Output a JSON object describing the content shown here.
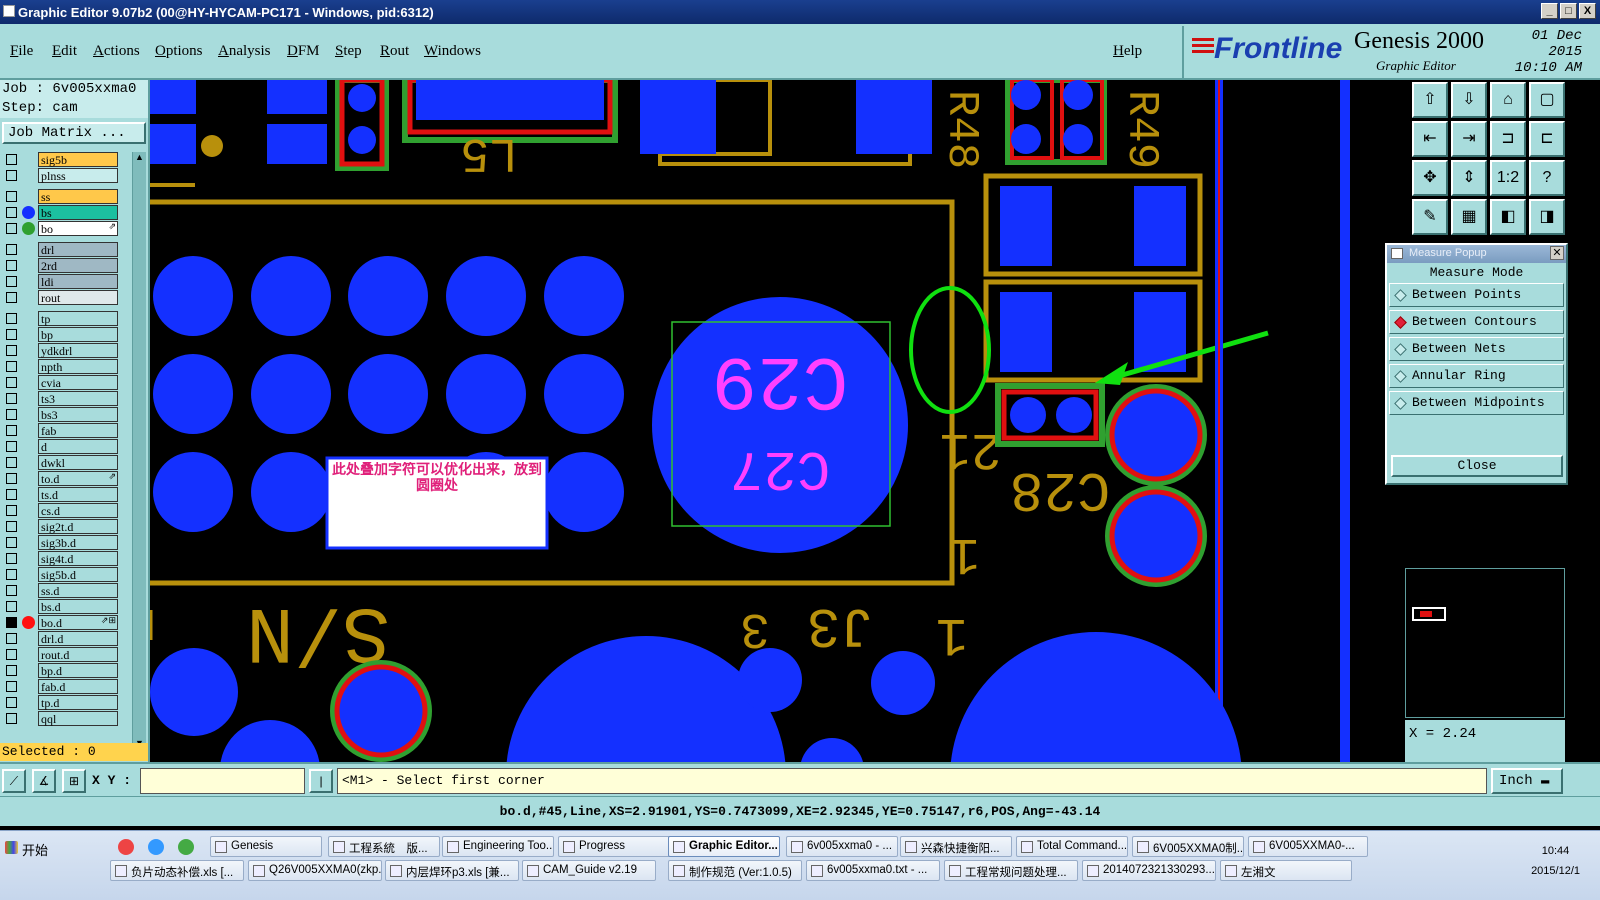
{
  "window": {
    "title": "Graphic Editor 9.07b2 (00@HY-HYCAM-PC171 - Windows, pid:6312)",
    "controls": [
      "_",
      "□",
      "X"
    ]
  },
  "menu": [
    "File",
    "Edit",
    "Actions",
    "Options",
    "Analysis",
    "DFM",
    "Step",
    "Rout",
    "Windows"
  ],
  "help": "Help",
  "brand": {
    "logo": "Frontline",
    "product": "Genesis 2000",
    "sub": "Graphic Editor",
    "date": "01 Dec 2015",
    "time": "10:10 AM",
    "logo_color": "#1a3fb0"
  },
  "job": {
    "job_label": "Job : 6v005xxma0",
    "step_label": "Step: cam",
    "matrix": "Job Matrix ..."
  },
  "layers": [
    {
      "name": "sig5b",
      "color": "#ffc84a",
      "dot": ""
    },
    {
      "name": "plnss",
      "color": "#c8ecec",
      "dot": "",
      "gap": true
    },
    {
      "name": "ss",
      "color": "#ffc84a",
      "dot": ""
    },
    {
      "name": "bs",
      "color": "#1cc0a0",
      "dot": "#1430ff"
    },
    {
      "name": "bo",
      "color": "#ffffff",
      "dot": "#30a030",
      "flag": "⇗",
      "gap": true
    },
    {
      "name": "drl",
      "color": "#9fb8c4",
      "dot": ""
    },
    {
      "name": "2rd",
      "color": "#9fb8c4",
      "dot": ""
    },
    {
      "name": "ldi",
      "color": "#9fb8c4",
      "dot": ""
    },
    {
      "name": "rout",
      "color": "#dfe8ea",
      "dot": "",
      "gap": true
    },
    {
      "name": "tp",
      "color": "#a8dcdc",
      "dot": ""
    },
    {
      "name": "bp",
      "color": "#a8dcdc",
      "dot": ""
    },
    {
      "name": "ydkdrl",
      "color": "#a8dcdc",
      "dot": ""
    },
    {
      "name": "npth",
      "color": "#a8dcdc",
      "dot": ""
    },
    {
      "name": "cvia",
      "color": "#a8dcdc",
      "dot": ""
    },
    {
      "name": "ts3",
      "color": "#a8dcdc",
      "dot": ""
    },
    {
      "name": "bs3",
      "color": "#a8dcdc",
      "dot": ""
    },
    {
      "name": "fab",
      "color": "#a8dcdc",
      "dot": ""
    },
    {
      "name": "d",
      "color": "#a8dcdc",
      "dot": ""
    },
    {
      "name": "dwkl",
      "color": "#a8dcdc",
      "dot": ""
    },
    {
      "name": "to.d",
      "color": "#a8dcdc",
      "dot": "",
      "flag": "⇗"
    },
    {
      "name": "ts.d",
      "color": "#a8dcdc",
      "dot": ""
    },
    {
      "name": "cs.d",
      "color": "#a8dcdc",
      "dot": ""
    },
    {
      "name": "sig2t.d",
      "color": "#a8dcdc",
      "dot": ""
    },
    {
      "name": "sig3b.d",
      "color": "#a8dcdc",
      "dot": ""
    },
    {
      "name": "sig4t.d",
      "color": "#a8dcdc",
      "dot": ""
    },
    {
      "name": "sig5b.d",
      "color": "#a8dcdc",
      "dot": ""
    },
    {
      "name": "ss.d",
      "color": "#a8dcdc",
      "dot": ""
    },
    {
      "name": "bs.d",
      "color": "#a8dcdc",
      "dot": ""
    },
    {
      "name": "bo.d",
      "color": "#a8dcdc",
      "dot": "#ff1010",
      "flag": "⇗⊞",
      "checked": true
    },
    {
      "name": "drl.d",
      "color": "#a8dcdc",
      "dot": ""
    },
    {
      "name": "rout.d",
      "color": "#a8dcdc",
      "dot": ""
    },
    {
      "name": "bp.d",
      "color": "#a8dcdc",
      "dot": ""
    },
    {
      "name": "fab.d",
      "color": "#a8dcdc",
      "dot": ""
    },
    {
      "name": "tp.d",
      "color": "#a8dcdc",
      "dot": ""
    },
    {
      "name": "qql",
      "color": "#a8dcdc",
      "dot": ""
    }
  ],
  "selected": "Selected : 0",
  "canvas": {
    "labels": {
      "c29": "C29",
      "c27": "C27",
      "c28": "C28",
      "l5": "L5",
      "r48": "R48",
      "r49": "R49",
      "sn": "S/N",
      "j3": "J3",
      "n1": "1",
      "n3": "3",
      "n1b": "1",
      "n21": "21"
    },
    "annotation": "此处叠加字符可以优化出来，放到圆圈处",
    "colors": {
      "pad": "#1430ff",
      "outline": "#b8900c",
      "silk": "#ff40ff",
      "mask": "#e01010",
      "green": "#30a030"
    }
  },
  "tools": [
    "⇧",
    "⇩",
    "⌂",
    "▢",
    "⇤",
    "⇥",
    "⊐",
    "⊏",
    "✥",
    "⇕",
    "1:2",
    "?",
    "✎",
    "▦",
    "◧",
    "◨"
  ],
  "measure": {
    "title": "Measure Popup",
    "heading": "Measure Mode",
    "options": [
      "Between Points",
      "Between Contours",
      "Between Nets",
      "Annular Ring",
      "Between Midpoints"
    ],
    "selected_index": 1,
    "close": "Close"
  },
  "xval": "X = 2.24",
  "cmd": {
    "xy_label": "X Y :",
    "prompt": "<M1> - Select first corner",
    "units": "Inch ▬"
  },
  "status": "bo.d,#45,Line,XS=2.91901,YS=0.7473099,XE=2.92345,YE=0.75147,r6,POS,Ang=-43.14",
  "taskbar": {
    "start": "开始",
    "row1": [
      "Genesis",
      "工程系統　版...",
      "Engineering Too...",
      "Progress",
      "Graphic Editor...",
      "6v005xxma0 - ...",
      "兴森快捷衡阳...",
      "Total Command...",
      "6V005XXMA0制...",
      "6V005XXMA0-..."
    ],
    "row2": [
      "负片动态补偿.xls [...",
      "Q26V005XXMA0(zkp...",
      "内层焊环p3.xls [兼...",
      "CAM_Guide v2.19",
      "制作规范 (Ver:1.0.5)",
      "6v005xxma0.txt - ...",
      "工程常规问题处理...",
      "2014072321330293...",
      "左湘文"
    ],
    "active_index": 4,
    "time": "10:44",
    "date": "2015/12/1"
  }
}
